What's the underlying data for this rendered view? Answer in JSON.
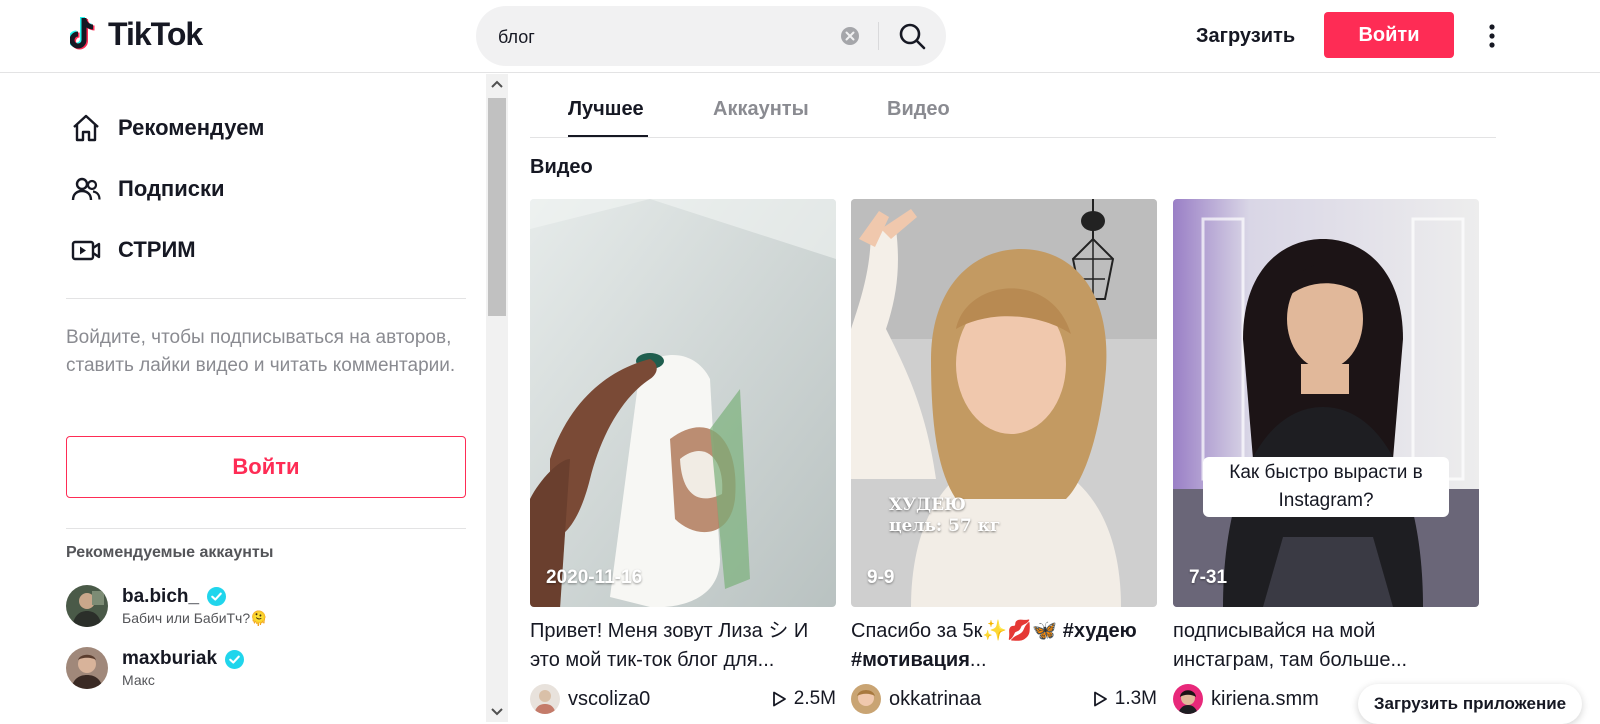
{
  "header": {
    "logo_text": "TikTok",
    "search_value": "блог",
    "upload_label": "Загрузить",
    "login_label": "Войти"
  },
  "sidebar": {
    "nav": [
      {
        "label": "Рекомендуем",
        "icon": "home-icon"
      },
      {
        "label": "Подписки",
        "icon": "users-icon"
      },
      {
        "label": "СТРИМ",
        "icon": "live-icon"
      }
    ],
    "login_hint": "Войдите, чтобы подписываться на авторов, ставить лайки видео и читать комментарии.",
    "login_button": "Войти",
    "recommended_title": "Рекомендуемые аккаунты",
    "accounts": [
      {
        "name": "ba.bich_",
        "subtitle": "Бабич или БабиТч?🫠",
        "verified": true
      },
      {
        "name": "maxburiak",
        "subtitle": "Макс",
        "verified": true
      }
    ]
  },
  "tabs": [
    {
      "label": "Лучшее",
      "active": true
    },
    {
      "label": "Аккаунты",
      "active": false
    },
    {
      "label": "Видео",
      "active": false
    }
  ],
  "section_title": "Видео",
  "videos": [
    {
      "date": "2020-11-16",
      "description": "Привет! Меня зовут Лиза シ И это мой тик-ток блог для...",
      "username": "vscoliza0",
      "views": "2.5M"
    },
    {
      "date": "9-9",
      "description_plain": "Спасибо за 5к✨💋🦋 ",
      "description_bold": "#худею #мотивация",
      "description_tail": "...",
      "overlay_line1": "ХУДЕЮ",
      "overlay_line2": "цель: 57 кг",
      "username": "okkatrinaa",
      "views": "1.3M"
    },
    {
      "date": "7-31",
      "description": "подписывайся на мой инстаграм, там больше...",
      "overlay_caption": "Как быстро вырасти в Instagram?",
      "username": "kiriena.smm"
    }
  ],
  "app_button": "Загрузить приложение",
  "colors": {
    "brand": "#fe2c55",
    "text": "#161823",
    "secondary": "#8a8b91",
    "verified": "#20d5ec"
  }
}
